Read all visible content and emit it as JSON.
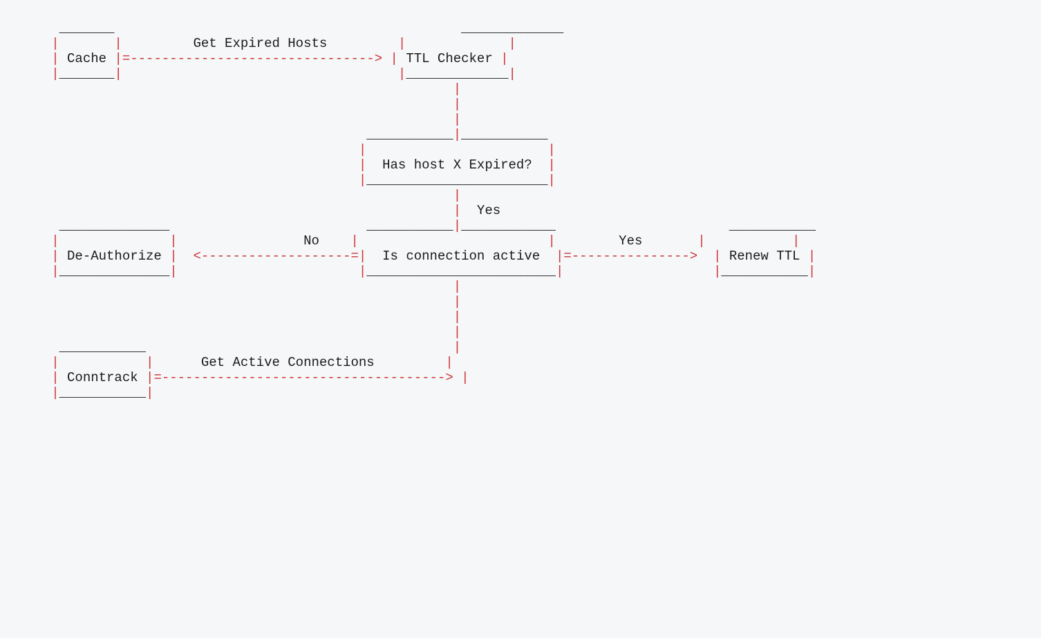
{
  "diagram": {
    "nodes": {
      "cache": "Cache",
      "ttl_checker": "TTL Checker",
      "has_expired": "Has host X Expired?",
      "deauthorize": "De-Authorize",
      "is_active": "Is connection active",
      "renew_ttl": "Renew TTL",
      "conntrack": "Conntrack"
    },
    "edges": {
      "get_expired_hosts": "Get Expired Hosts",
      "yes_1": "Yes",
      "no": "No",
      "yes_2": "Yes",
      "get_active_conns": "Get Active Connections"
    }
  },
  "chart_data": {
    "type": "flowchart",
    "nodes": [
      {
        "id": "cache",
        "label": "Cache"
      },
      {
        "id": "ttl_checker",
        "label": "TTL Checker"
      },
      {
        "id": "has_expired",
        "label": "Has host X Expired?",
        "kind": "decision"
      },
      {
        "id": "is_active",
        "label": "Is connection active",
        "kind": "decision"
      },
      {
        "id": "deauthorize",
        "label": "De-Authorize"
      },
      {
        "id": "renew_ttl",
        "label": "Renew TTL"
      },
      {
        "id": "conntrack",
        "label": "Conntrack"
      }
    ],
    "edges": [
      {
        "from": "cache",
        "to": "ttl_checker",
        "label": "Get Expired Hosts"
      },
      {
        "from": "ttl_checker",
        "to": "has_expired",
        "label": ""
      },
      {
        "from": "has_expired",
        "to": "is_active",
        "label": "Yes"
      },
      {
        "from": "is_active",
        "to": "deauthorize",
        "label": "No"
      },
      {
        "from": "is_active",
        "to": "renew_ttl",
        "label": "Yes"
      },
      {
        "from": "conntrack",
        "to": "is_active",
        "label": "Get Active Connections"
      }
    ]
  }
}
